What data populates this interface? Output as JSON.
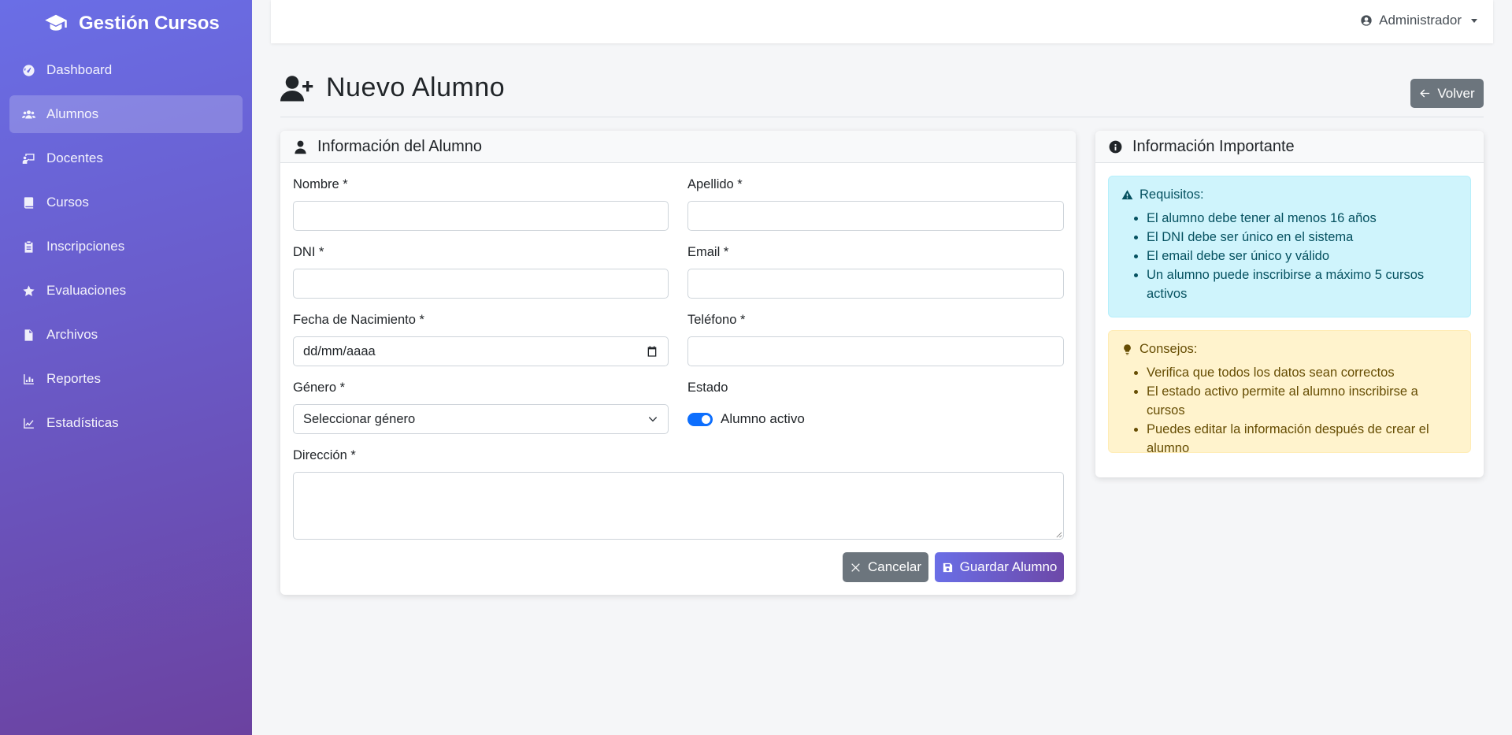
{
  "sidebar": {
    "brand": "Gestión Cursos",
    "items": [
      {
        "label": "Dashboard",
        "icon": "tachometer-icon"
      },
      {
        "label": "Alumnos",
        "icon": "users-icon",
        "active": true
      },
      {
        "label": "Docentes",
        "icon": "chalkboard-teacher-icon"
      },
      {
        "label": "Cursos",
        "icon": "book-icon"
      },
      {
        "label": "Inscripciones",
        "icon": "clipboard-icon"
      },
      {
        "label": "Evaluaciones",
        "icon": "star-icon"
      },
      {
        "label": "Archivos",
        "icon": "file-icon"
      },
      {
        "label": "Reportes",
        "icon": "bar-chart-icon"
      },
      {
        "label": "Estadísticas",
        "icon": "line-chart-icon"
      }
    ]
  },
  "topbar": {
    "user": "Administrador"
  },
  "header": {
    "title": "Nuevo Alumno",
    "back_label": "Volver"
  },
  "form": {
    "card_title": "Información del Alumno",
    "nombre_label": "Nombre *",
    "apellido_label": "Apellido *",
    "dni_label": "DNI *",
    "email_label": "Email *",
    "fecha_label": "Fecha de Nacimiento *",
    "fecha_placeholder": "dd/mm/aaaa",
    "telefono_label": "Teléfono *",
    "genero_label": "Género *",
    "genero_value": "Seleccionar género",
    "estado_label": "Estado",
    "estado_switch_label": "Alumno activo",
    "direccion_label": "Dirección *",
    "cancel_label": "Cancelar",
    "save_label": "Guardar Alumno"
  },
  "info": {
    "card_title": "Información Importante",
    "requisitos_title": "Requisitos:",
    "requisitos": [
      "El alumno debe tener al menos 16 años",
      "El DNI debe ser único en el sistema",
      "El email debe ser único y válido",
      "Un alumno puede inscribirse a máximo 5 cursos activos"
    ],
    "consejos_title": "Consejos:",
    "consejos": [
      "Verifica que todos los datos sean correctos",
      "El estado activo permite al alumno inscribirse a cursos",
      "Puedes editar la información después de crear el alumno"
    ]
  },
  "colors": {
    "sidebar_gradient_start": "#6a6ee6",
    "sidebar_gradient_end": "#6b42a0",
    "info_alert_bg": "#cff4fc",
    "warning_alert_bg": "#fff3cd",
    "switch_on": "#0d6efd"
  }
}
